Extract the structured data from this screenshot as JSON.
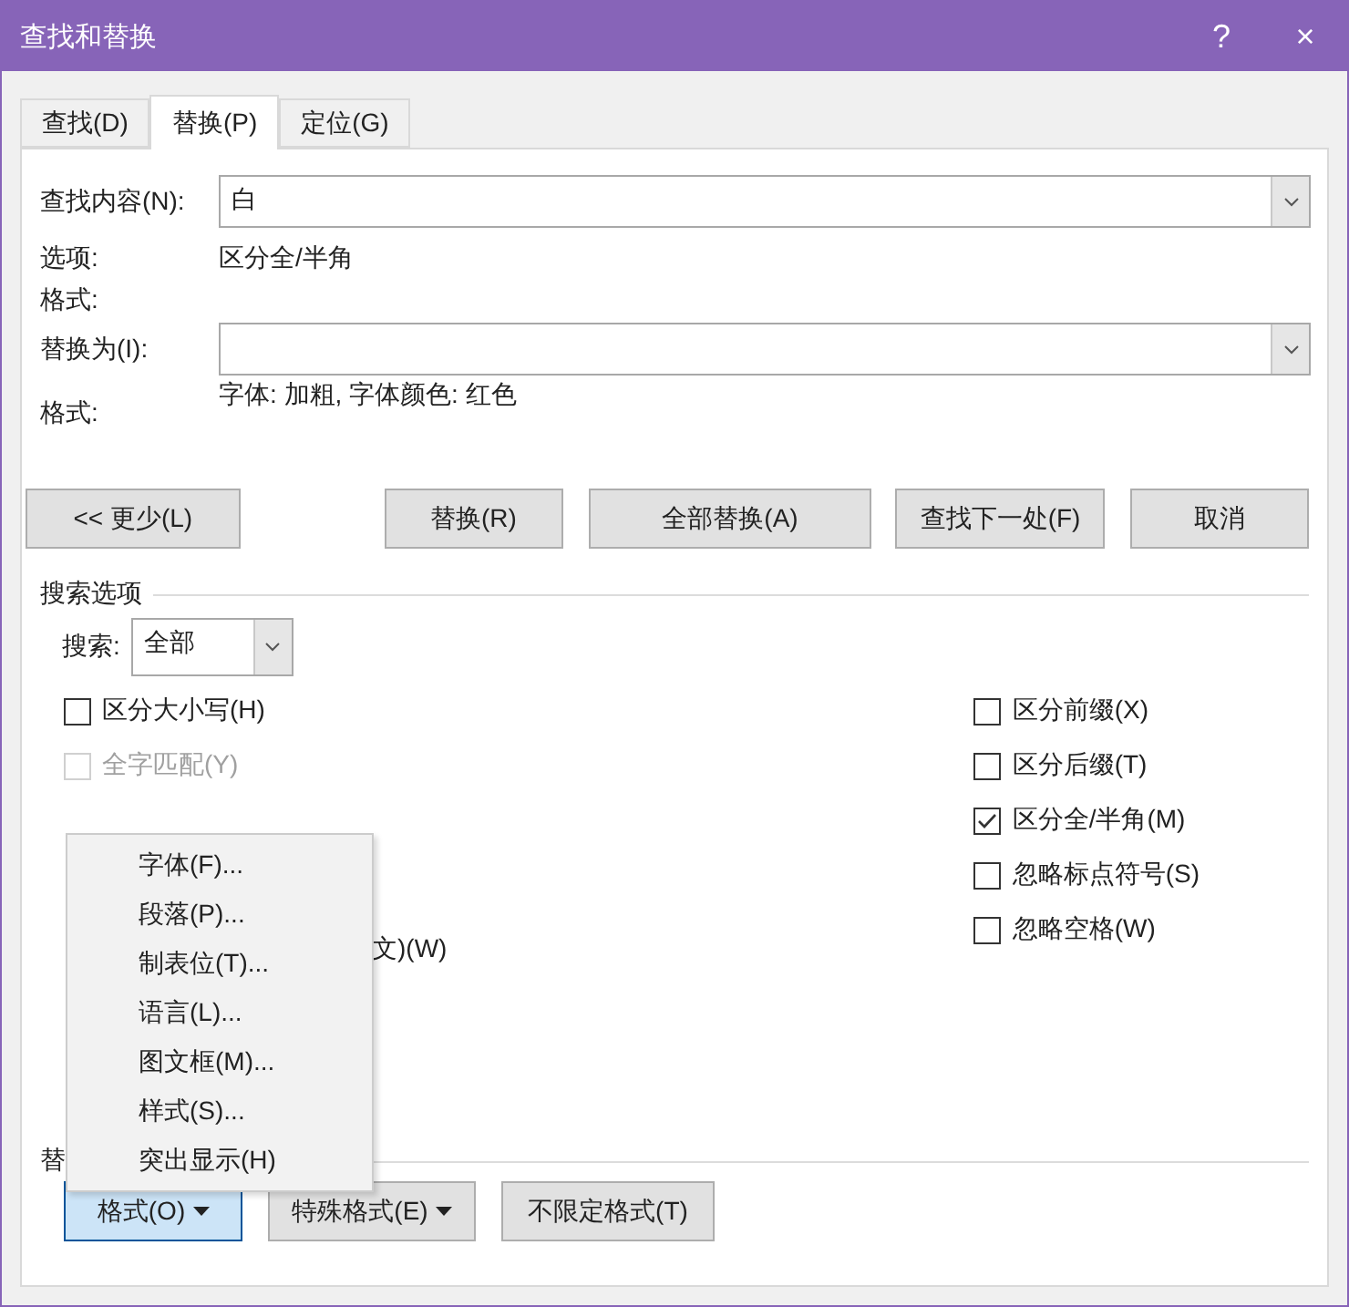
{
  "window": {
    "title": "查找和替换",
    "help": "?",
    "close": "×"
  },
  "tabs": [
    {
      "label": "查找(D)",
      "selected": false
    },
    {
      "label": "替换(P)",
      "selected": true
    },
    {
      "label": "定位(G)",
      "selected": false
    }
  ],
  "find": {
    "label": "查找内容(N):",
    "value": "白",
    "options_label": "选项:",
    "options_value": "区分全/半角",
    "format_label": "格式:"
  },
  "replace": {
    "label": "替换为(I):",
    "format_label": "格式:",
    "format_value": "字体: 加粗, 字体颜色: 红色"
  },
  "buttons": [
    {
      "label": "<< 更少(L)"
    },
    {
      "label": "替换(R)"
    },
    {
      "label": "全部替换(A)"
    },
    {
      "label": "查找下一处(F)"
    },
    {
      "label": "取消"
    }
  ],
  "search_options": {
    "title": "搜索选项",
    "search_label": "搜索:",
    "search_value": "全部",
    "left_options": [
      {
        "label": "区分大小写(H)",
        "checked": false,
        "disabled": false
      },
      {
        "label": "全字匹配(Y)",
        "checked": false,
        "disabled": true
      }
    ],
    "hidden_option_tail": "文)(W)",
    "right_options": [
      {
        "label": "区分前缀(X)",
        "checked": false,
        "disabled": false
      },
      {
        "label": "区分后缀(T)",
        "checked": false,
        "disabled": false
      },
      {
        "label": "区分全/半角(M)",
        "checked": true,
        "disabled": false
      },
      {
        "label": "忽略标点符号(S)",
        "checked": false,
        "disabled": false
      },
      {
        "label": "忽略空格(W)",
        "checked": false,
        "disabled": false
      }
    ]
  },
  "replace_section": {
    "title": "替"
  },
  "bottom_buttons": [
    {
      "label": "格式(O)",
      "dropdown": true,
      "selected": true
    },
    {
      "label": "特殊格式(E)",
      "dropdown": true,
      "selected": false
    },
    {
      "label": "不限定格式(T)",
      "dropdown": false,
      "selected": false
    }
  ],
  "format_menu": [
    {
      "label": "字体(F)..."
    },
    {
      "label": "段落(P)..."
    },
    {
      "label": "制表位(T)..."
    },
    {
      "label": "语言(L)..."
    },
    {
      "label": "图文框(M)..."
    },
    {
      "label": "样式(S)..."
    },
    {
      "label": "突出显示(H)"
    }
  ]
}
